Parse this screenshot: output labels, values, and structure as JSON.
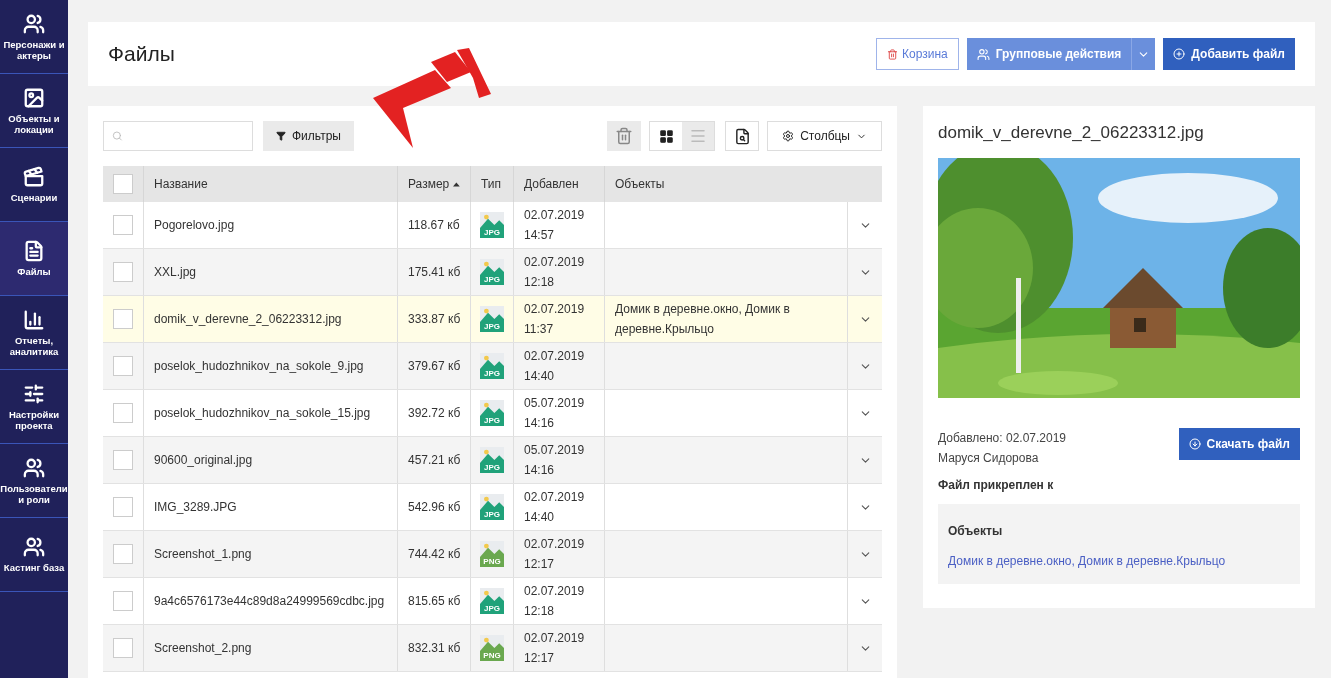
{
  "sidebar": {
    "items": [
      {
        "label": "Персонажи и актеры",
        "selected": false
      },
      {
        "label": "Объекты и локации",
        "selected": false
      },
      {
        "label": "Сценарии",
        "selected": false
      },
      {
        "label": "Файлы",
        "selected": true
      },
      {
        "label": "Отчеты, аналитика",
        "selected": false
      },
      {
        "label": "Настройки проекта",
        "selected": false
      },
      {
        "label": "Пользователи и роли",
        "selected": false
      },
      {
        "label": "Кастинг база",
        "selected": false
      }
    ]
  },
  "header": {
    "title": "Файлы",
    "buttons": [
      {
        "label": "Корзина",
        "kind": "outline"
      },
      {
        "label": "Групповые действия",
        "kind": "split"
      },
      {
        "label": "Добавить файл",
        "kind": "primary"
      }
    ]
  },
  "toolbar": {
    "filter_label": "Фильтры",
    "grid_view": {
      "selected": true
    },
    "list_view": {
      "selected": false
    },
    "columns_label": "Столбцы"
  },
  "table": {
    "header_checkbox": {
      "checked": false
    },
    "columns": [
      "Название",
      "Размер",
      "Тип",
      "Добавлен",
      "Объекты"
    ],
    "rows": [
      {
        "name": "Pogorelovo.jpg",
        "size": "118.67 кб",
        "type": "JPG",
        "date": "02.07.2019",
        "time": "14:57",
        "checked": false,
        "selected": false
      },
      {
        "name": "XXL.jpg",
        "size": "175.41 кб",
        "type": "JPG",
        "date": "02.07.2019",
        "time": "12:18",
        "checked": false,
        "selected": false
      },
      {
        "name": "domik_v_derevne_2_06223312.jpg",
        "size": "333.87 кб",
        "type": "JPG",
        "date": "02.07.2019",
        "time": "11:37",
        "objects": "Домик в деревне.окно, Домик в деревне.Крыльцо",
        "checked": false,
        "selected": true
      },
      {
        "name": "poselok_hudozhnikov_na_sokole_9.jpg",
        "size": "379.67 кб",
        "type": "JPG",
        "date": "02.07.2019",
        "time": "14:40",
        "checked": false,
        "selected": false
      },
      {
        "name": "poselok_hudozhnikov_na_sokole_15.jpg",
        "size": "392.72 кб",
        "type": "JPG",
        "date": "05.07.2019",
        "time": "14:16",
        "checked": false,
        "selected": false
      },
      {
        "name": "90600_original.jpg",
        "size": "457.21 кб",
        "type": "JPG",
        "date": "05.07.2019",
        "time": "14:16",
        "checked": false,
        "selected": false
      },
      {
        "name": "IMG_3289.JPG",
        "size": "542.96 кб",
        "type": "JPG",
        "date": "02.07.2019",
        "time": "14:40",
        "checked": false,
        "selected": false
      },
      {
        "name": "Screenshot_1.png",
        "size": "744.42 кб",
        "type": "PNG",
        "date": "02.07.2019",
        "time": "12:17",
        "checked": false,
        "selected": false
      },
      {
        "name": "9a4c6576173e44c89d8a24999569cdbc.jpg",
        "size": "815.65 кб",
        "type": "JPG",
        "date": "02.07.2019",
        "time": "12:18",
        "checked": false,
        "selected": false
      },
      {
        "name": "Screenshot_2.png",
        "size": "832.31 кб",
        "type": "PNG",
        "date": "02.07.2019",
        "time": "12:17",
        "checked": false,
        "selected": false
      }
    ]
  },
  "preview": {
    "title": "domik_v_derevne_2_06223312.jpg",
    "added": "Добавлено: 02.07.2019",
    "author": "Маруся Сидорова",
    "download_label": "Скачать файл",
    "attached_heading": "Файл прикреплен к",
    "objects_heading": "Объекты",
    "objects_link": "Домик в деревне.окно, Домик в деревне.Крыльцо"
  }
}
